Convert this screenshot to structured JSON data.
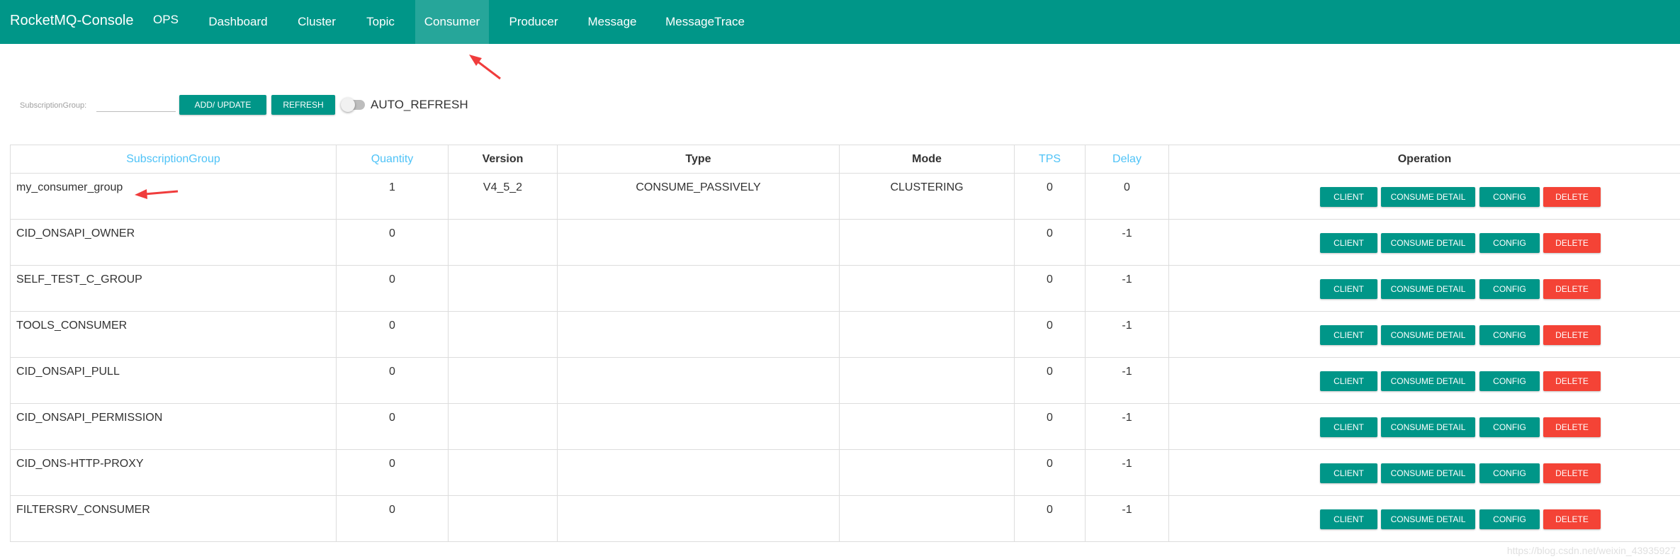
{
  "navbar": {
    "brand": "RocketMQ-Console",
    "items": [
      {
        "label": "OPS"
      },
      {
        "label": "Dashboard"
      },
      {
        "label": "Cluster"
      },
      {
        "label": "Topic"
      },
      {
        "label": "Consumer"
      },
      {
        "label": "Producer"
      },
      {
        "label": "Message"
      },
      {
        "label": "MessageTrace"
      }
    ],
    "active_item": "Consumer"
  },
  "toolbar": {
    "filter_label": "SubscriptionGroup:",
    "filter_value": "",
    "add_update_label": "ADD/ UPDATE",
    "refresh_label": "REFRESH",
    "auto_refresh_label": "AUTO_REFRESH",
    "auto_refresh_on": false
  },
  "table": {
    "columns": [
      "SubscriptionGroup",
      "Quantity",
      "Version",
      "Type",
      "Mode",
      "TPS",
      "Delay",
      "Operation"
    ],
    "sortable_columns": [
      "SubscriptionGroup",
      "Quantity",
      "TPS",
      "Delay"
    ],
    "row_actions": {
      "client": "CLIENT",
      "consume_detail": "CONSUME DETAIL",
      "config": "CONFIG",
      "delete": "DELETE"
    },
    "rows": [
      {
        "group": "my_consumer_group",
        "quantity": "1",
        "version": "V4_5_2",
        "type": "CONSUME_PASSIVELY",
        "mode": "CLUSTERING",
        "tps": "0",
        "delay": "0"
      },
      {
        "group": "CID_ONSAPI_OWNER",
        "quantity": "0",
        "version": "",
        "type": "",
        "mode": "",
        "tps": "0",
        "delay": "-1"
      },
      {
        "group": "SELF_TEST_C_GROUP",
        "quantity": "0",
        "version": "",
        "type": "",
        "mode": "",
        "tps": "0",
        "delay": "-1"
      },
      {
        "group": "TOOLS_CONSUMER",
        "quantity": "0",
        "version": "",
        "type": "",
        "mode": "",
        "tps": "0",
        "delay": "-1"
      },
      {
        "group": "CID_ONSAPI_PULL",
        "quantity": "0",
        "version": "",
        "type": "",
        "mode": "",
        "tps": "0",
        "delay": "-1"
      },
      {
        "group": "CID_ONSAPI_PERMISSION",
        "quantity": "0",
        "version": "",
        "type": "",
        "mode": "",
        "tps": "0",
        "delay": "-1"
      },
      {
        "group": "CID_ONS-HTTP-PROXY",
        "quantity": "0",
        "version": "",
        "type": "",
        "mode": "",
        "tps": "0",
        "delay": "-1"
      },
      {
        "group": "FILTERSRV_CONSUMER",
        "quantity": "0",
        "version": "",
        "type": "",
        "mode": "",
        "tps": "0",
        "delay": "-1"
      }
    ]
  },
  "colors": {
    "primary": "#009688",
    "nav_active": "#26a69a",
    "danger": "#f44336",
    "sortable_header": "#4fc3f7",
    "annotation_arrow": "#f03c3c"
  },
  "watermark": "https://blog.csdn.net/weixin_43935927"
}
